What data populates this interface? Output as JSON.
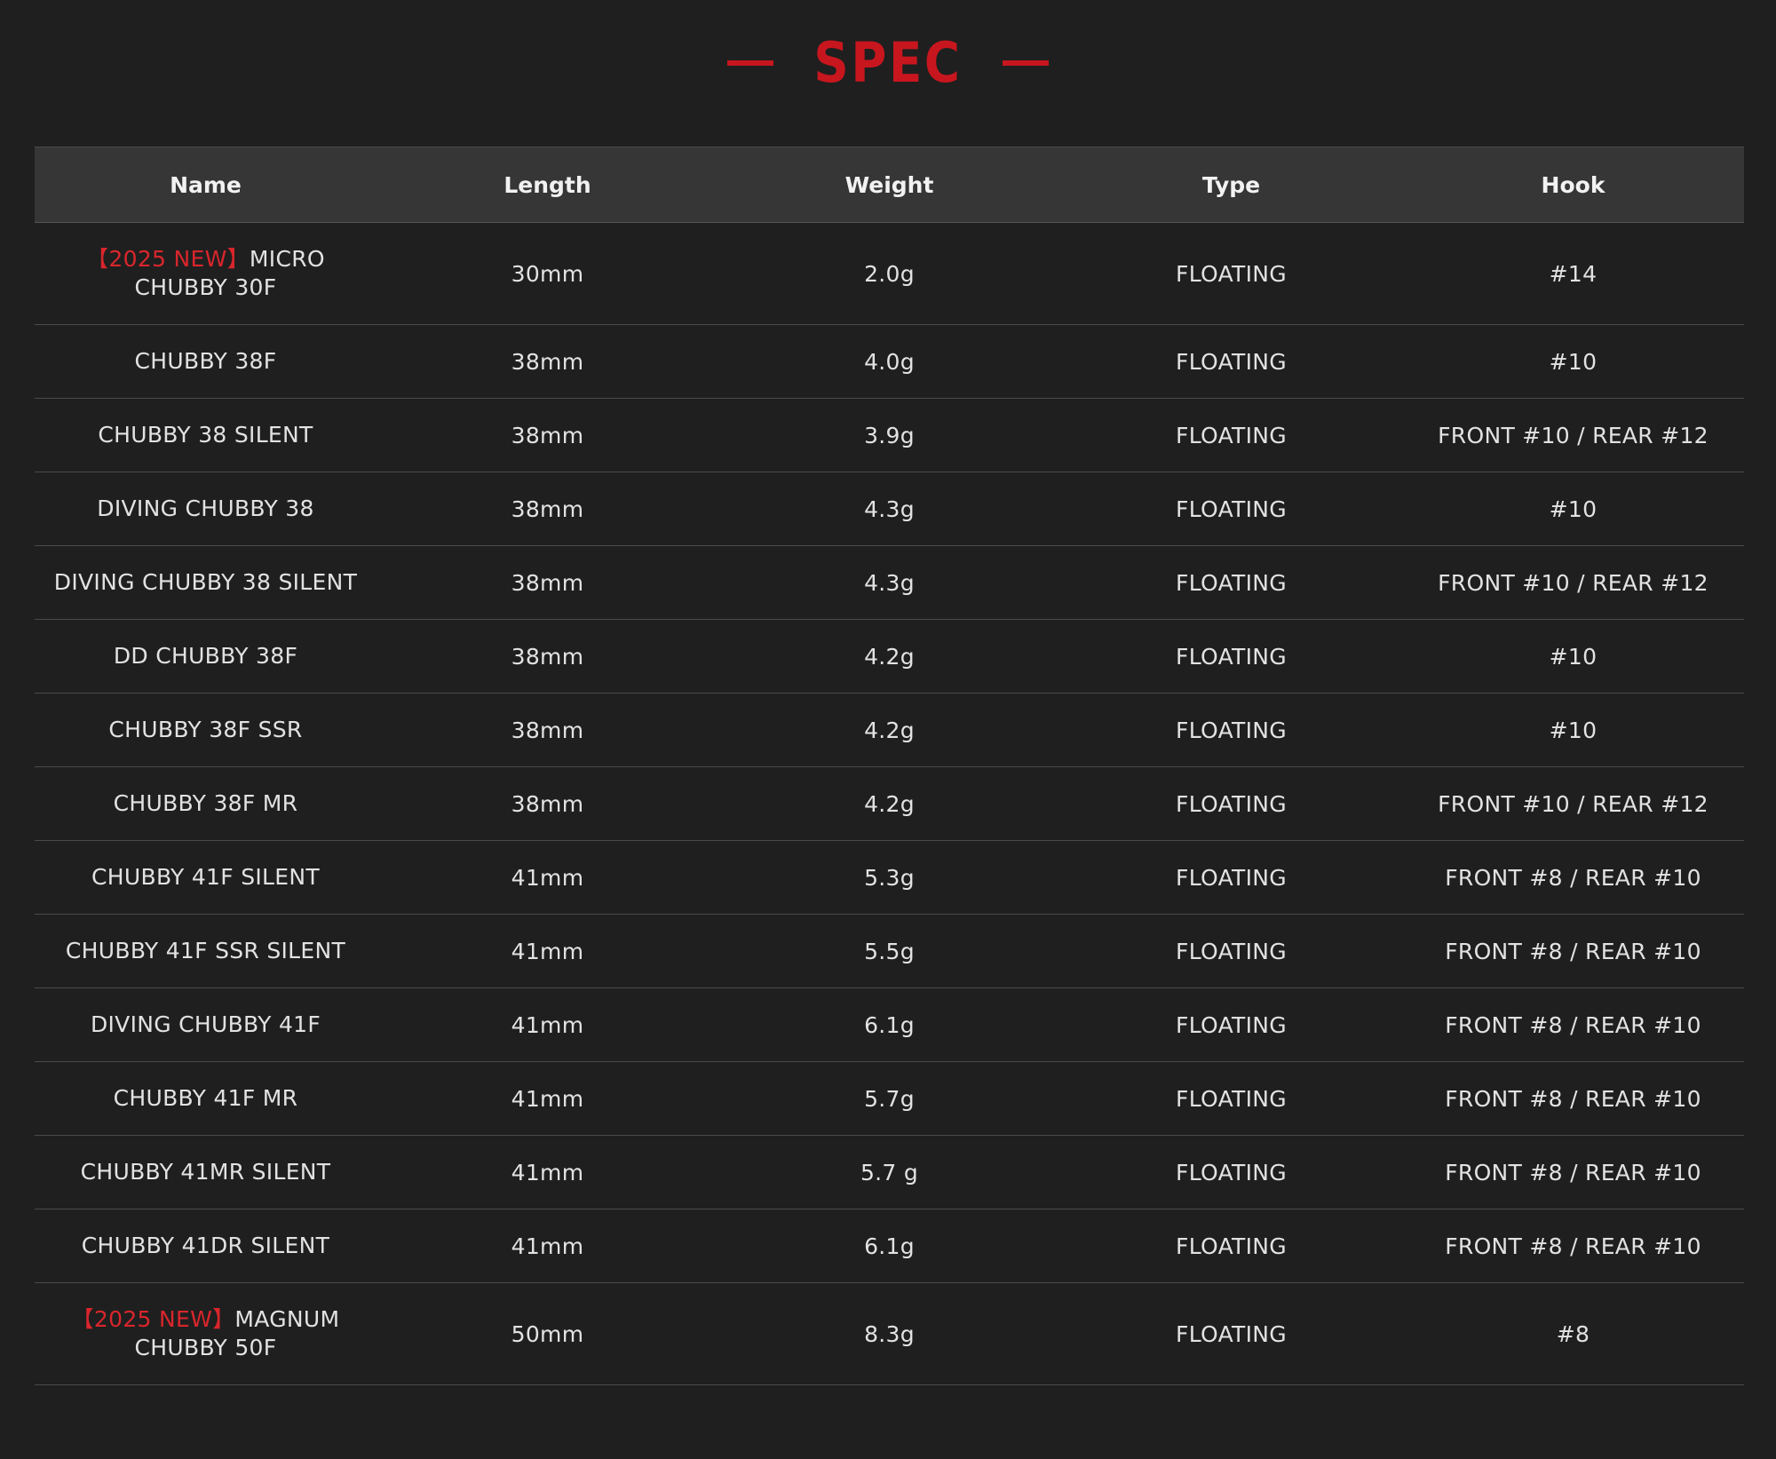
{
  "title": "SPEC",
  "colors": {
    "accent": "#c8161e",
    "background": "#1f1f1f",
    "header_bg": "#363636"
  },
  "table": {
    "headers": [
      "Name",
      "Length",
      "Weight",
      "Type",
      "Hook"
    ],
    "rows": [
      {
        "tag": "【2025 NEW】",
        "name": "MICRO CHUBBY 30F",
        "length": "30mm",
        "weight": "2.0g",
        "type": "FLOATING",
        "hook": "#14"
      },
      {
        "tag": "",
        "name": "CHUBBY 38F",
        "length": "38mm",
        "weight": "4.0g",
        "type": "FLOATING",
        "hook": "#10"
      },
      {
        "tag": "",
        "name": "CHUBBY 38 SILENT",
        "length": "38mm",
        "weight": "3.9g",
        "type": "FLOATING",
        "hook": "FRONT #10 / REAR #12"
      },
      {
        "tag": "",
        "name": "DIVING CHUBBY 38",
        "length": "38mm",
        "weight": "4.3g",
        "type": "FLOATING",
        "hook": "#10"
      },
      {
        "tag": "",
        "name": "DIVING CHUBBY 38 SILENT",
        "length": "38mm",
        "weight": "4.3g",
        "type": "FLOATING",
        "hook": "FRONT #10 / REAR #12"
      },
      {
        "tag": "",
        "name": "DD CHUBBY 38F",
        "length": "38mm",
        "weight": "4.2g",
        "type": "FLOATING",
        "hook": "#10"
      },
      {
        "tag": "",
        "name": "CHUBBY 38F SSR",
        "length": "38mm",
        "weight": "4.2g",
        "type": "FLOATING",
        "hook": "#10"
      },
      {
        "tag": "",
        "name": "CHUBBY 38F MR",
        "length": "38mm",
        "weight": "4.2g",
        "type": "FLOATING",
        "hook": "FRONT #10 / REAR #12"
      },
      {
        "tag": "",
        "name": "CHUBBY 41F SILENT",
        "length": "41mm",
        "weight": "5.3g",
        "type": "FLOATING",
        "hook": "FRONT #8 / REAR #10"
      },
      {
        "tag": "",
        "name": "CHUBBY 41F SSR SILENT",
        "length": "41mm",
        "weight": "5.5g",
        "type": "FLOATING",
        "hook": "FRONT #8 / REAR #10"
      },
      {
        "tag": "",
        "name": "DIVING CHUBBY 41F",
        "length": "41mm",
        "weight": "6.1g",
        "type": "FLOATING",
        "hook": "FRONT #8 / REAR #10"
      },
      {
        "tag": "",
        "name": "CHUBBY 41F MR",
        "length": "41mm",
        "weight": "5.7g",
        "type": "FLOATING",
        "hook": "FRONT #8 / REAR #10"
      },
      {
        "tag": "",
        "name": "CHUBBY 41MR SILENT",
        "length": "41mm",
        "weight": "5.7 g",
        "type": "FLOATING",
        "hook": "FRONT #8 / REAR #10"
      },
      {
        "tag": "",
        "name": "CHUBBY 41DR SILENT",
        "length": "41mm",
        "weight": "6.1g",
        "type": "FLOATING",
        "hook": "FRONT #8 / REAR #10"
      },
      {
        "tag": "【2025 NEW】",
        "name": "MAGNUM CHUBBY 50F",
        "length": "50mm",
        "weight": "8.3g",
        "type": "FLOATING",
        "hook": "#8"
      }
    ]
  }
}
